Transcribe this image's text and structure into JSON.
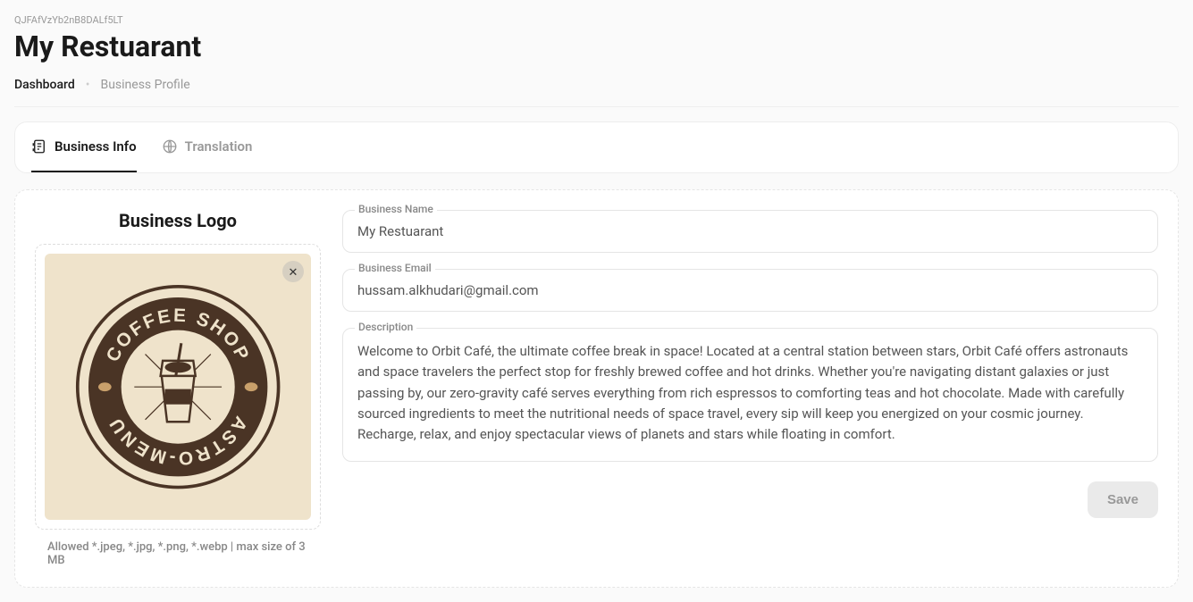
{
  "header": {
    "id": "QJFAfVzYb2nB8DALf5LT",
    "title": "My Restuarant"
  },
  "breadcrumb": {
    "root": "Dashboard",
    "current": "Business Profile"
  },
  "tabs": {
    "info": "Business Info",
    "translation": "Translation"
  },
  "logo": {
    "title": "Business Logo",
    "hint": "Allowed *.jpeg, *.jpg, *.png, *.webp | max size of 3 MB",
    "badge_top": "COFFEE SHOP",
    "badge_bottom": "ASTRO-MENU"
  },
  "form": {
    "name_label": "Business Name",
    "name_value": "My Restuarant",
    "email_label": "Business Email",
    "email_value": "hussam.alkhudari@gmail.com",
    "desc_label": "Description",
    "desc_value": "Welcome to Orbit Café, the ultimate coffee break in space! Located at a central station between stars, Orbit Café offers astronauts and space travelers the perfect stop for freshly brewed coffee and hot drinks. Whether you're navigating distant galaxies or just passing by, our zero-gravity café serves everything from rich espressos to comforting teas and hot chocolate. Made with carefully sourced ingredients to meet the nutritional needs of space travel, every sip will keep you energized on your cosmic journey. Recharge, relax, and enjoy spectacular views of planets and stars while floating in comfort."
  },
  "actions": {
    "save": "Save"
  }
}
